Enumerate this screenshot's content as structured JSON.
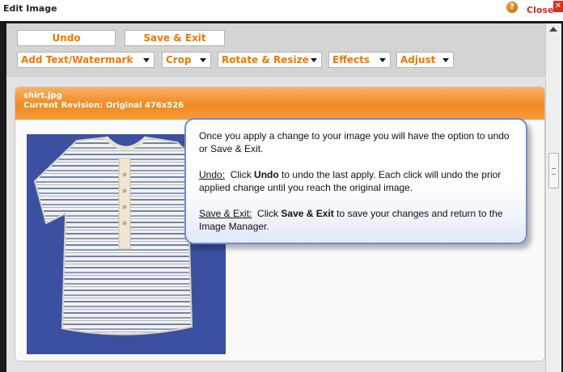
{
  "window": {
    "title": "Edit Image",
    "close_label": "Close"
  },
  "toolbar": {
    "undo_label": "Undo",
    "save_exit_label": "Save & Exit",
    "menus": [
      {
        "label": "Add Text/Watermark"
      },
      {
        "label": "Crop"
      },
      {
        "label": "Rotate & Resize"
      },
      {
        "label": "Effects"
      },
      {
        "label": "Adjust"
      }
    ]
  },
  "image_panel": {
    "file_name": "shirt.jpg",
    "revision": "Current Revision: Original 476x526"
  },
  "tooltip": {
    "line1": "Once you apply a change to your image you will have the option to undo or Save & Exit.",
    "undo_term": "Undo:",
    "undo_pre": "Click",
    "undo_bold": "Undo",
    "undo_post": "to undo the last apply.  Each click will undo the prior applied change until you reach the original image.",
    "save_term": "Save & Exit:",
    "save_pre": "Click",
    "save_bold": "Save & Exit",
    "save_post": "to save your changes and return to the Image Manager."
  },
  "colors": {
    "accent": "#f07800",
    "header_orange": "#f08a20",
    "tooltip_border": "#6f8ad8",
    "close_red": "#e0251b"
  },
  "icons": {
    "help": "help-icon",
    "close": "close-icon",
    "dropdown": "chevron-down-icon"
  }
}
